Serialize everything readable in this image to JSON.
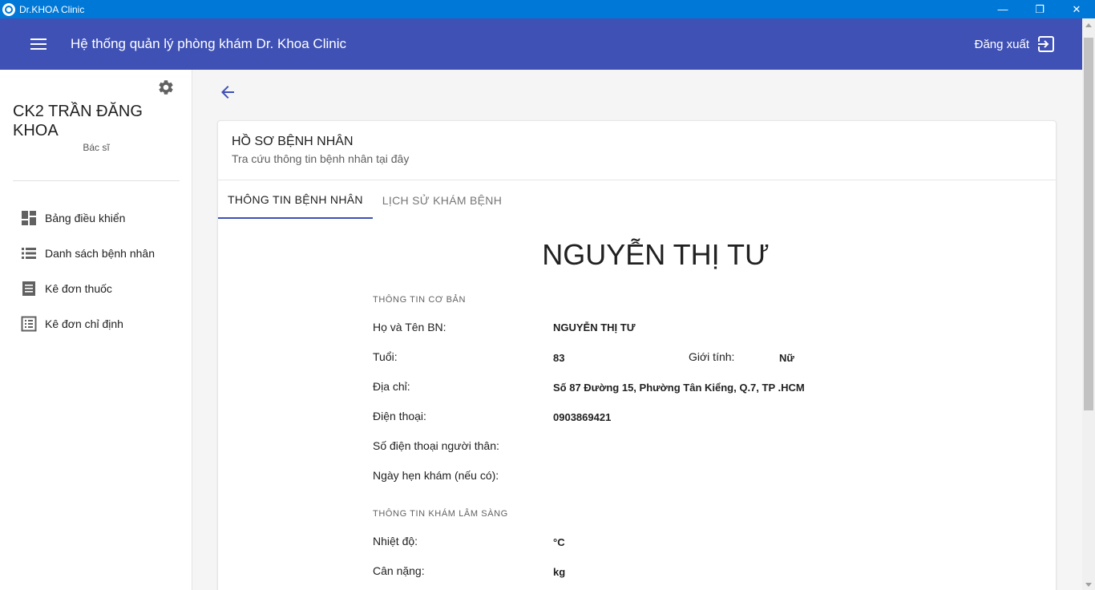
{
  "window": {
    "title": "Dr.KHOA Clinic",
    "minimize": "—",
    "restore": "❐",
    "close": "✕"
  },
  "header": {
    "title": "Hệ thống quản lý phòng khám Dr. Khoa Clinic",
    "logout_label": "Đăng xuất"
  },
  "sidebar": {
    "doctor_name": "CK2 TRẦN ĐĂNG KHOA",
    "doctor_role": "Bác sĩ",
    "items": [
      {
        "label": "Bảng điều khiển",
        "icon": "dashboard-icon"
      },
      {
        "label": "Danh sách bệnh nhân",
        "icon": "list-icon"
      },
      {
        "label": "Kê đơn thuốc",
        "icon": "receipt-icon"
      },
      {
        "label": "Kê đơn chỉ định",
        "icon": "list-alt-icon"
      }
    ]
  },
  "card": {
    "title": "HỒ SƠ BỆNH NHÂN",
    "subtitle": "Tra cứu thông tin bệnh nhân tại đây",
    "tabs": [
      "THÔNG TIN BỆNH NHÂN",
      "LỊCH SỬ KHÁM BỆNH"
    ],
    "active_tab": 0
  },
  "patient": {
    "display_name": "NGUYỄN THỊ TƯ",
    "basic_section": "THÔNG TIN CƠ BẢN",
    "clinical_section": "THÔNG TIN KHÁM LÂM SÀNG",
    "fields": {
      "name_label": "Họ và Tên BN:",
      "name_value": "NGUYỄN THỊ TƯ",
      "age_label": "Tuổi:",
      "age_value": "83",
      "gender_label": "Giới tính:",
      "gender_value": "Nữ",
      "address_label": "Địa chỉ:",
      "address_value": "Số 87 Đường 15, Phường Tân Kiểng, Q.7, TP .HCM",
      "phone_label": "Điện thoại:",
      "phone_value": "0903869421",
      "relative_phone_label": "Số điện thoại người thân:",
      "relative_phone_value": "",
      "appointment_label": "Ngày hẹn khám (nếu có):",
      "appointment_value": "",
      "temperature_label": "Nhiệt độ:",
      "temperature_value": "°C",
      "weight_label": "Cân nặng:",
      "weight_value": "kg"
    }
  },
  "colors": {
    "titlebar": "#0078d7",
    "primary": "#3f51b5",
    "background": "#f5f5f5"
  }
}
